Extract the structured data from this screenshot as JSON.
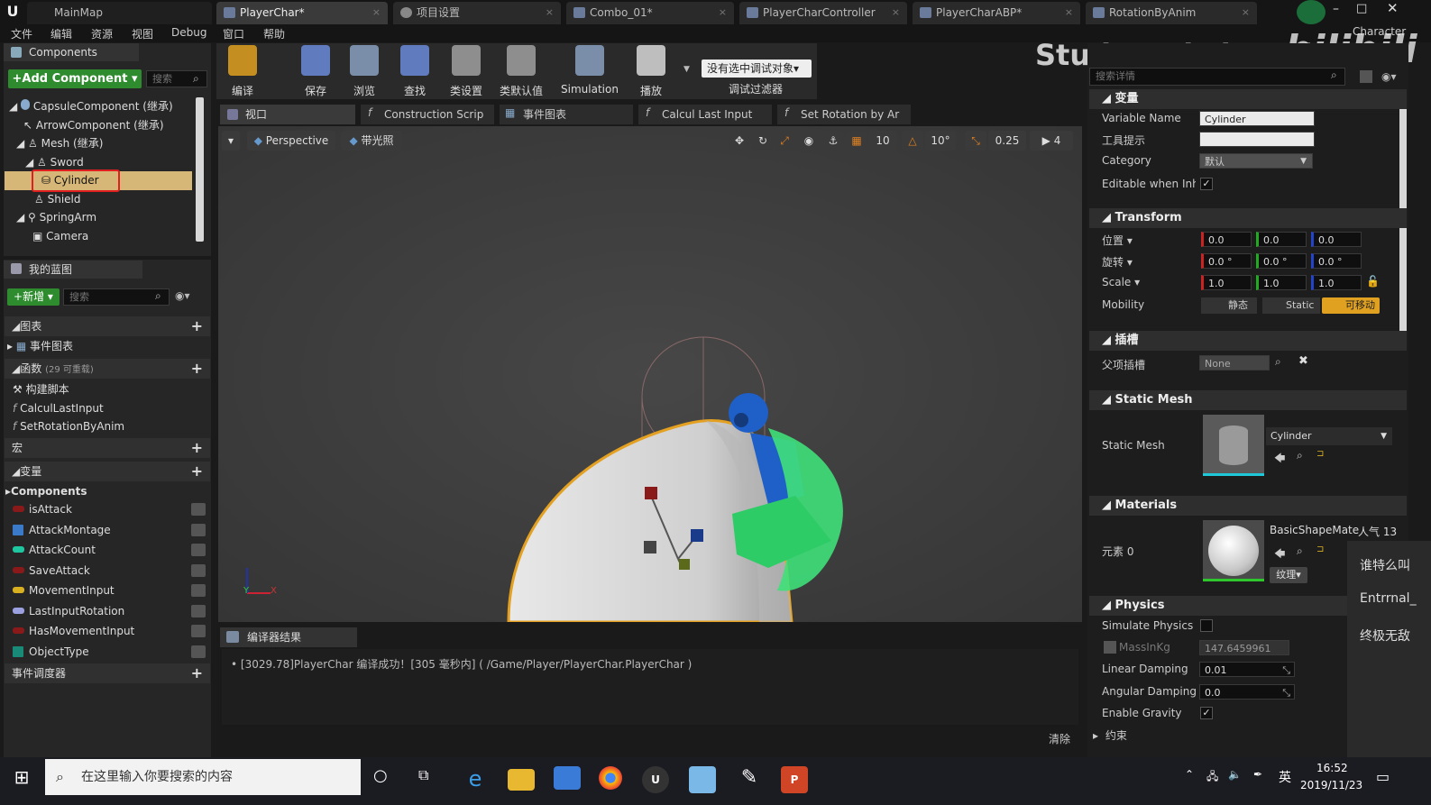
{
  "tabs": [
    {
      "label": "MainMap"
    },
    {
      "label": "PlayerChar*"
    },
    {
      "label": "项目设置"
    },
    {
      "label": "Combo_01*"
    },
    {
      "label": "PlayerCharController"
    },
    {
      "label": "PlayerCharABP*"
    },
    {
      "label": "RotationByAnim"
    }
  ],
  "window_right_label": "Character",
  "menu": [
    "文件",
    "编辑",
    "资源",
    "视图",
    "Debug",
    "窗口",
    "帮助"
  ],
  "components": {
    "title": "Components",
    "add_button": "+Add Component ▾",
    "search_placeholder": "搜索",
    "tree": [
      "CapsuleComponent (继承)",
      "ArrowComponent (继承)",
      "Mesh (继承)",
      "Sword",
      "Cylinder",
      "Shield",
      "SpringArm",
      "Camera"
    ]
  },
  "my_blueprint": {
    "title": "我的蓝图",
    "new_button": "+新增 ▾",
    "search_placeholder": "搜索",
    "sections": {
      "graphs": "图表",
      "event_graph": "事件图表",
      "functions": "函数",
      "functions_count": "(29 可重载)",
      "construction": "构建脚本",
      "func1": "CalculLastInput",
      "func2": "SetRotationByAnim",
      "macros": "宏",
      "variables": "变量",
      "components": "Components",
      "dispatchers": "事件调度器"
    },
    "variables": [
      {
        "name": "isAttack",
        "color": "#8a1a1a"
      },
      {
        "name": "AttackMontage",
        "color": "#3a7ac8"
      },
      {
        "name": "AttackCount",
        "color": "#1fc7a0"
      },
      {
        "name": "SaveAttack",
        "color": "#8a1a1a"
      },
      {
        "name": "MovementInput",
        "color": "#d8b020"
      },
      {
        "name": "LastInputRotation",
        "color": "#9aa0e0"
      },
      {
        "name": "HasMovementInput",
        "color": "#8a1a1a"
      },
      {
        "name": "ObjectType",
        "color": "#1a8a78"
      }
    ]
  },
  "toolbar": {
    "buttons": [
      "编译",
      "保存",
      "浏览",
      "查找",
      "类设置",
      "类默认值",
      "Simulation",
      "播放"
    ],
    "debug_select": "没有选中调试对象▾",
    "debug_filter": "调试过滤器"
  },
  "editor_tabs": [
    "视口",
    "Construction Scrip",
    "事件图表",
    "Calcul Last Input",
    "Set Rotation by Ar"
  ],
  "viewport": {
    "perspective": "Perspective",
    "lit": "带光照",
    "grid_snap": "10",
    "rot_snap": "10°",
    "scale_snap": "0.25",
    "cam_speed": "4"
  },
  "compiler": {
    "title": "编译器结果",
    "message": "[3029.78]PlayerChar 编译成功！[305 毫秒内] ( /Game/Player/PlayerChar.PlayerChar )",
    "clear": "清除"
  },
  "watermark": "StudentLittleRed",
  "watermark_logo": "bilibili",
  "details": {
    "search_placeholder": "搜索详情",
    "variable_section": "变量",
    "variable_name_label": "Variable Name",
    "variable_name": "Cylinder",
    "tooltip_label": "工具提示",
    "category_label": "Category",
    "category": "默认",
    "editable_label": "Editable when Inher",
    "transform_section": "Transform",
    "location_label": "位置 ▾",
    "location": [
      "0.0",
      "0.0",
      "0.0"
    ],
    "rotation_label": "旋转 ▾",
    "rotation": [
      "0.0 °",
      "0.0 °",
      "0.0 °"
    ],
    "scale_label": "Scale ▾",
    "scale": [
      "1.0",
      "1.0",
      "1.0"
    ],
    "mobility_label": "Mobility",
    "mobility_options": [
      "静态",
      "Static",
      "可移动"
    ],
    "sockets_section": "插槽",
    "parent_socket_label": "父项插槽",
    "parent_socket": "None",
    "static_mesh_section": "Static Mesh",
    "static_mesh_label": "Static Mesh",
    "static_mesh": "Cylinder",
    "materials_section": "Materials",
    "element_label": "元素 0",
    "material": "BasicShapeMater",
    "texture_button": "纹理▾",
    "physics_section": "Physics",
    "simulate_physics": "Simulate Physics",
    "mass_label": "MassInKg",
    "mass": "147.6459961",
    "linear_damping_label": "Linear Damping",
    "linear_damping": "0.01",
    "angular_damping_label": "Angular Damping",
    "angular_damping": "0.0",
    "enable_gravity": "Enable Gravity",
    "constraints": "约束"
  },
  "chat_overlay": {
    "popularity": "人气  13",
    "lines": [
      "谁特么叫",
      "Entrrnal_",
      "终极无敌"
    ]
  },
  "taskbar": {
    "search_placeholder": "在这里输入你要搜索的内容",
    "ime": "英",
    "time": "16:52",
    "date": "2019/11/23"
  },
  "colors": {
    "accent_green": "#34a034",
    "selection": "#d6b777",
    "highlight_red": "#e02020",
    "ue_dark": "#262626"
  }
}
